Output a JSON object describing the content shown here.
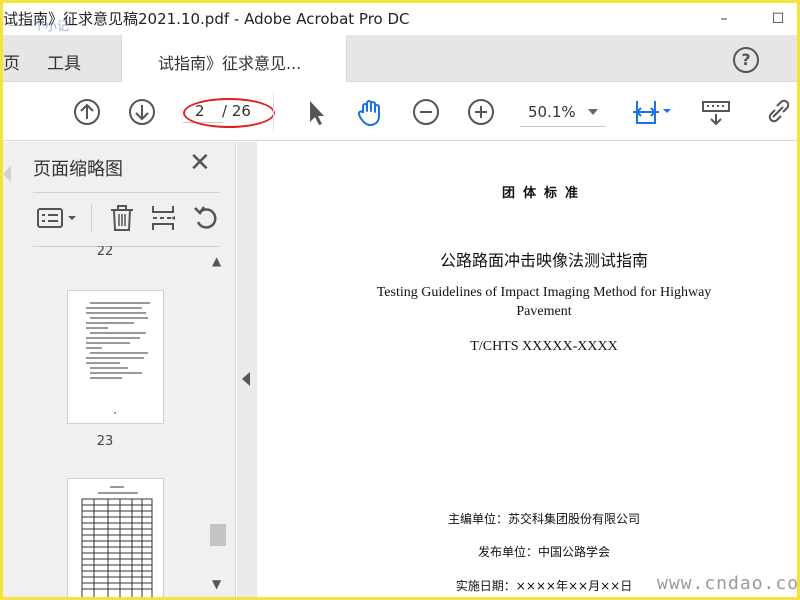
{
  "window": {
    "title": "试指南》征求意见稿2021.10.pdf - Adobe Acrobat Pro DC",
    "minimize_label": "–",
    "maximize_label": "☐"
  },
  "tabs": {
    "home": "页",
    "tools": "工具",
    "document": "试指南》征求意见...",
    "help": "?"
  },
  "toolbar": {
    "current_page": "2",
    "total_pages": "/ 26",
    "zoom": "50.1%"
  },
  "thumbnail_panel": {
    "title": "页面缩略图",
    "pages": [
      {
        "label": "22"
      },
      {
        "label": "23"
      }
    ]
  },
  "document": {
    "standard_type": "团体标准",
    "title_cn": "公路路面冲击映像法测试指南",
    "title_en_line1": "Testing Guidelines of Impact Imaging Method for Highway",
    "title_en_line2": "Pavement",
    "code": "T/CHTS XXXXX-XXXX",
    "chief_org": "主编单位：苏交科集团股份有限公司",
    "publisher": "发布单位：中国公路学会",
    "effective_date": "实施日期：××××年××月××日"
  },
  "watermark": {
    "site": "www.cndao.com",
    "corner_mark": "一一个小记"
  },
  "colors": {
    "frame_border": "#f6e23a",
    "accent_blue": "#1473e6",
    "annotation_red": "#e02020"
  }
}
